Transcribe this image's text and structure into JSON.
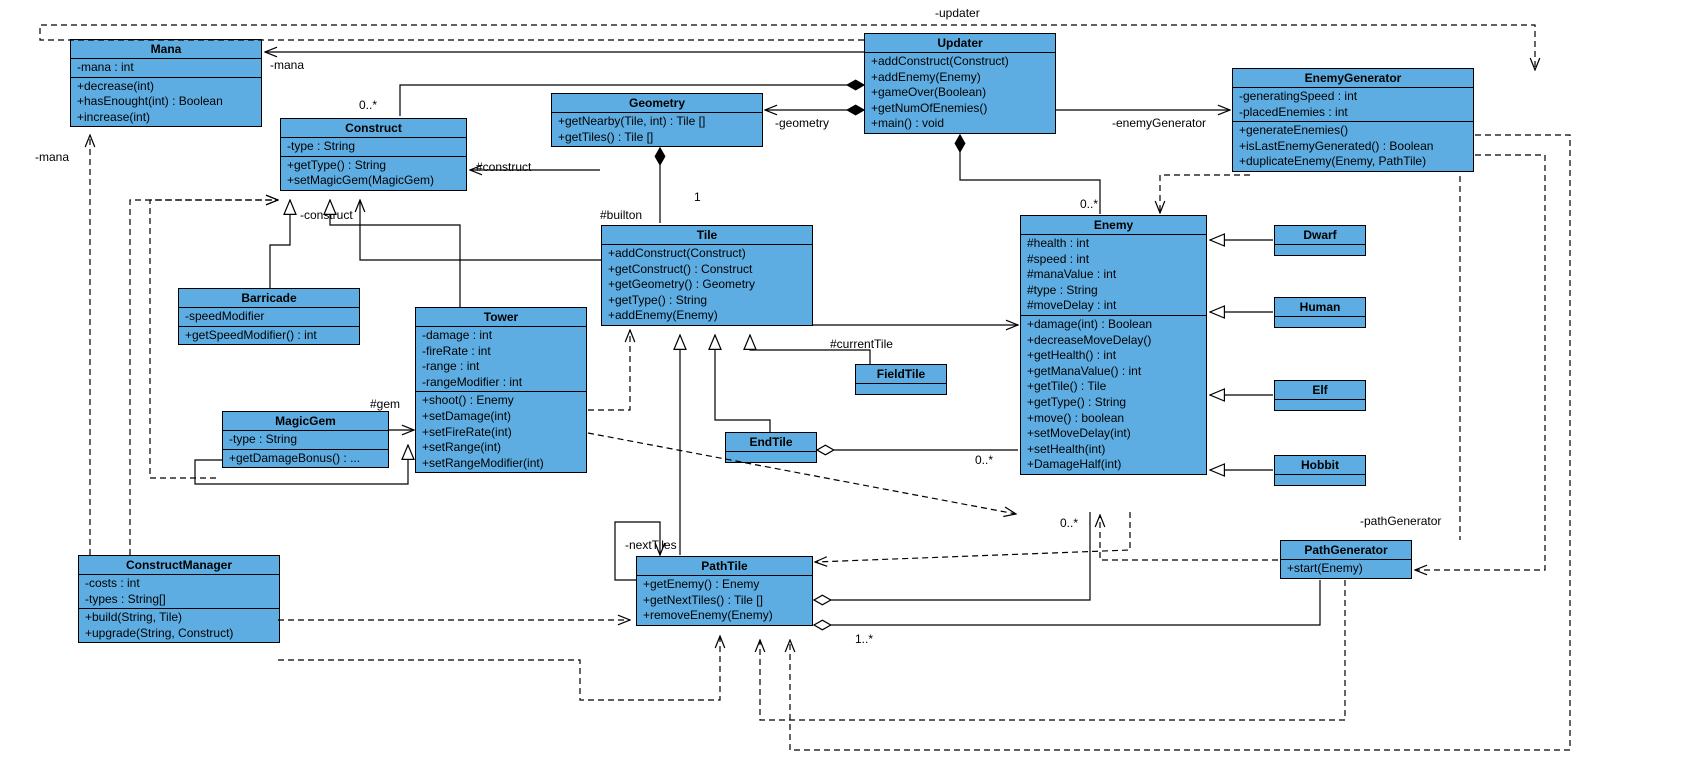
{
  "classes": {
    "Mana": {
      "attrs": [
        "-mana : int"
      ],
      "ops": [
        "+decrease(int)",
        "+hasEnought(int) : Boolean",
        "+increase(int)"
      ]
    },
    "Construct": {
      "attrs": [
        "-type : String"
      ],
      "ops": [
        "+getType() : String",
        "+setMagicGem(MagicGem)"
      ]
    },
    "Geometry": {
      "attrs": [],
      "ops": [
        "+getNearby(Tile, int) : Tile []",
        "+getTiles() : Tile []"
      ]
    },
    "Updater": {
      "attrs": [],
      "ops": [
        "+addConstruct(Construct)",
        "+addEnemy(Enemy)",
        "+gameOver(Boolean)",
        "+getNumOfEnemies()",
        "+main() : void"
      ]
    },
    "EnemyGenerator": {
      "attrs": [
        "-generatingSpeed : int",
        "-placedEnemies : int"
      ],
      "ops": [
        "+generateEnemies()",
        "+isLastEnemyGenerated() : Boolean",
        "+duplicateEnemy(Enemy, PathTile)"
      ]
    },
    "Barricade": {
      "attrs": [
        "-speedModifier"
      ],
      "ops": [
        "+getSpeedModifier() : int"
      ]
    },
    "Tower": {
      "attrs": [
        "-damage : int",
        "-fireRate : int",
        "-range : int",
        "-rangeModifier : int"
      ],
      "ops": [
        "+shoot() : Enemy",
        "+setDamage(int)",
        "+setFireRate(int)",
        "+setRange(int)",
        "+setRangeModifier(int)"
      ]
    },
    "MagicGem": {
      "attrs": [
        "-type : String"
      ],
      "ops": [
        "+getDamageBonus() : ..."
      ]
    },
    "Tile": {
      "attrs": [],
      "ops": [
        "+addConstruct(Construct)",
        "+getConstruct() : Construct",
        "+getGeometry() : Geometry",
        "+getType() : String",
        "+addEnemy(Enemy)"
      ]
    },
    "Enemy": {
      "attrs": [
        "#health : int",
        "#speed : int",
        "#manaValue : int",
        "#type : String",
        "#moveDelay : int"
      ],
      "ops": [
        "+damage(int) : Boolean",
        "+decreaseMoveDelay()",
        "+getHealth() : int",
        "+getManaValue() : int",
        "+getTile() : Tile",
        "+getType() : String",
        "+move() : boolean",
        "+setMoveDelay(int)",
        "+setHealth(int)",
        "+DamageHalf(int)"
      ]
    },
    "Dwarf": {
      "attrs": [],
      "ops": []
    },
    "Human": {
      "attrs": [],
      "ops": []
    },
    "Elf": {
      "attrs": [],
      "ops": []
    },
    "Hobbit": {
      "attrs": [],
      "ops": []
    },
    "FieldTile": {
      "attrs": [],
      "ops": []
    },
    "EndTile": {
      "attrs": [],
      "ops": []
    },
    "PathTile": {
      "attrs": [],
      "ops": [
        "+getEnemy() : Enemy",
        "+getNextTiles() : Tile []",
        "+removeEnemy(Enemy)"
      ]
    },
    "PathGenerator": {
      "attrs": [],
      "ops": [
        "+start(Enemy)"
      ]
    },
    "ConstructManager": {
      "attrs": [
        "-costs : int",
        "-types : String[]"
      ],
      "ops": [
        "+build(String, Tile)",
        "+upgrade(String, Construct)"
      ]
    }
  },
  "labels": {
    "updater": "-updater",
    "mana": "-mana",
    "mana2": "-mana",
    "constructMult": "0..*",
    "construct": "#construct",
    "construct2": "-construct",
    "geometry": "-geometry",
    "enemyGenerator": "-enemyGenerator",
    "builton": "#builton",
    "one": "1",
    "gem": "#gem",
    "currentTile": "#currentTile",
    "enemyMult": "0..*",
    "enemyMult2": "0..*",
    "endMult": "0..*",
    "pathMult": "1..*",
    "nextTiles": "-nextTiles",
    "pathGenerator": "-pathGenerator"
  }
}
